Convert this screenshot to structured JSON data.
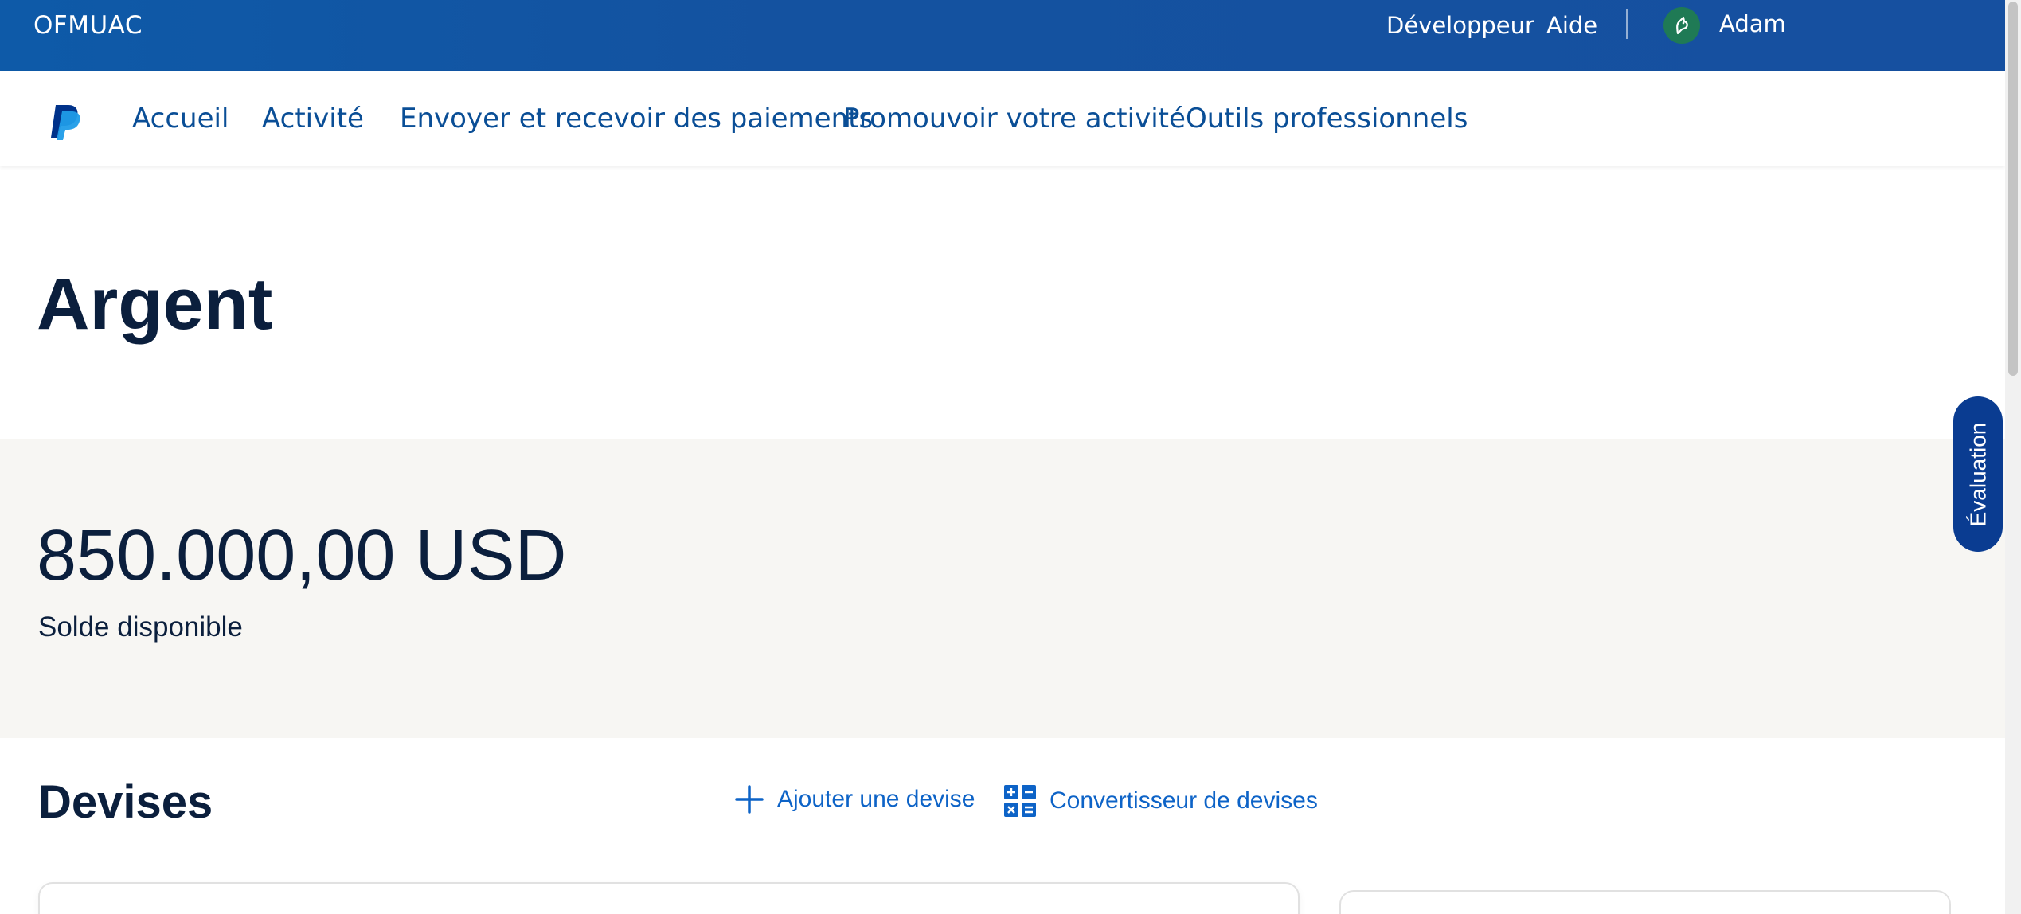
{
  "topbar": {
    "brand": "OFMUAC",
    "developer": "Développeur",
    "help": "Aide",
    "user_name": "Adam"
  },
  "nav": {
    "items": [
      {
        "label": "Accueil"
      },
      {
        "label": "Activité"
      },
      {
        "label": "Envoyer et recevoir des paiements"
      },
      {
        "label": "Promouvoir votre activité"
      },
      {
        "label": "Outils professionnels"
      }
    ]
  },
  "page": {
    "title": "Argent"
  },
  "balance": {
    "amount": "850.000,00 USD",
    "label": "Solde disponible"
  },
  "currencies": {
    "title": "Devises",
    "add_label": "Ajouter une devise",
    "converter_label": "Convertisseur de devises"
  },
  "feedback": {
    "label": "Évaluation"
  },
  "colors": {
    "topbar": "#1452a0",
    "link": "#0d63c7",
    "heading": "#0b1f3d",
    "balance_bg": "#f7f6f3",
    "eval_bg": "#0a3c91"
  },
  "icons": {
    "logo": "paypal-logo-icon",
    "avatar": "user-avatar-icon",
    "add": "plus-icon",
    "converter": "calculator-icon"
  }
}
